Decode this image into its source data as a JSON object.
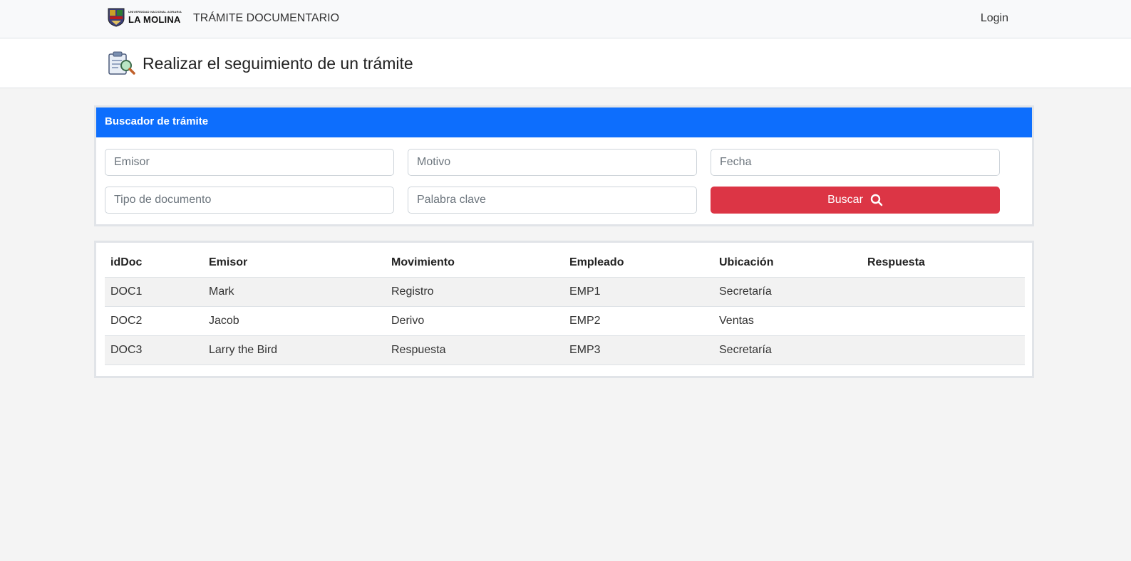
{
  "navbar": {
    "brand_small": "UNIVERSIDAD NACIONAL AGRARIA",
    "brand_big": "LA MOLINA",
    "title": "TRÁMITE DOCUMENTARIO",
    "login": "Login"
  },
  "page": {
    "title": "Realizar el seguimiento de un trámite",
    "icon": "clipboard-search-icon"
  },
  "search": {
    "header": "Buscador de trámite",
    "emisor_placeholder": "Emisor",
    "motivo_placeholder": "Motivo",
    "fecha_placeholder": "Fecha",
    "tipo_placeholder": "Tipo de documento",
    "palabra_placeholder": "Palabra clave",
    "button_label": "Buscar",
    "button_icon": "search-icon"
  },
  "table": {
    "columns": [
      "idDoc",
      "Emisor",
      "Movimiento",
      "Empleado",
      "Ubicación",
      "Respuesta"
    ],
    "rows": [
      [
        "DOC1",
        "Mark",
        "Registro",
        "EMP1",
        "Secretaría",
        ""
      ],
      [
        "DOC2",
        "Jacob",
        "Derivo",
        "EMP2",
        "Ventas",
        ""
      ],
      [
        "DOC3",
        "Larry the Bird",
        "Respuesta",
        "EMP3",
        "Secretaría",
        ""
      ]
    ]
  },
  "colors": {
    "primary": "#0d6efd",
    "danger": "#dc3545",
    "background": "#f4f4f4"
  }
}
